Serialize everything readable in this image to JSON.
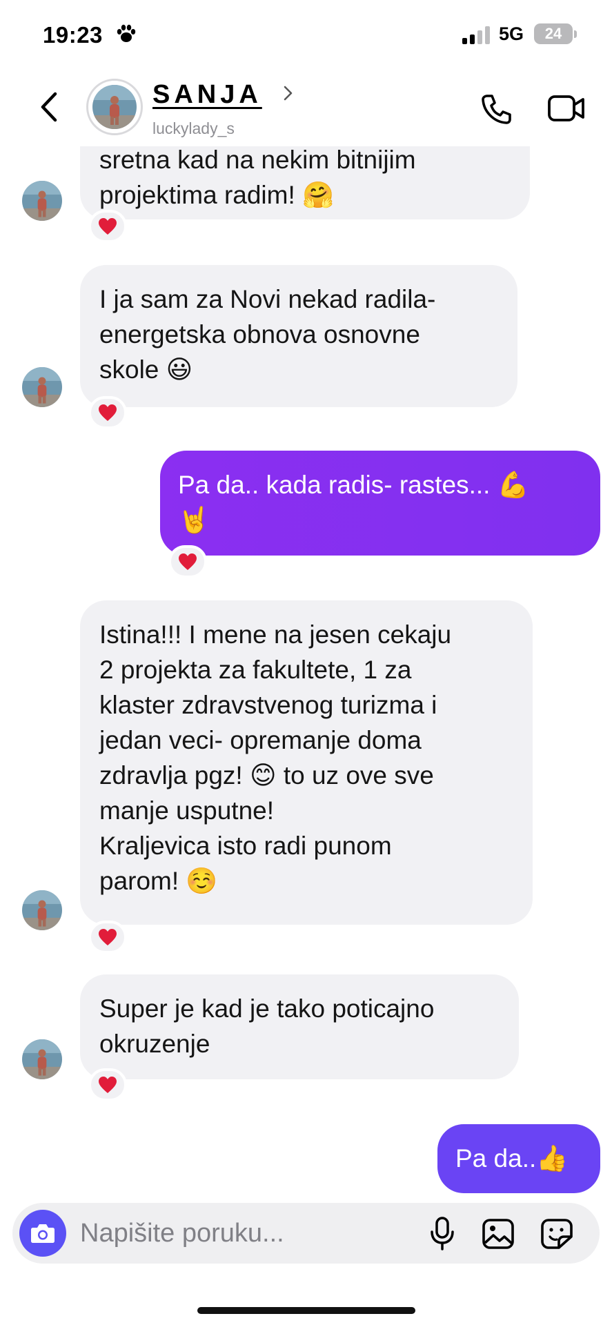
{
  "status_bar": {
    "time": "19:23",
    "network": "5G",
    "battery": "24",
    "icons": [
      "paw-icon",
      "signal-icon"
    ]
  },
  "header": {
    "contact_name": "SANJA",
    "contact_handle": "luckylady_s",
    "icons": [
      "back-icon",
      "chevron-right-icon",
      "phone-icon",
      "video-call-icon"
    ]
  },
  "colors": {
    "accent": "#5b51f5",
    "outgoing_purple": "#8a2ff0",
    "outgoing_indigo": "#6a44f4",
    "incoming_bubble": "#f1f1f4",
    "reaction_heart": "#e11d3a"
  },
  "messages": [
    {
      "direction": "incoming",
      "lines": [
        "sretna kad na nekim bitnijim",
        "projektima radim! 🤗"
      ],
      "reaction": "❤️"
    },
    {
      "direction": "incoming",
      "lines": [
        "I ja sam za Novi nekad radila-",
        "energetska obnova osnovne",
        "skole 😃"
      ],
      "reaction": "❤️"
    },
    {
      "direction": "outgoing",
      "lines": [
        "Pa da.. kada radis- rastes... 💪",
        "🤘"
      ],
      "reaction": "❤️"
    },
    {
      "direction": "incoming",
      "lines": [
        "Istina!!! I mene na jesen cekaju",
        "2 projekta za fakultete, 1 za",
        "klaster zdravstvenog turizma i",
        "jedan veci- opremanje doma",
        "zdravlja pgz! 😊 to uz ove sve",
        "manje usputne!",
        "Kraljevica isto radi punom",
        "parom! ☺️"
      ],
      "reaction": "❤️"
    },
    {
      "direction": "incoming",
      "lines": [
        "Super je kad je tako poticajno",
        "okruzenje"
      ],
      "reaction": "❤️"
    },
    {
      "direction": "outgoing",
      "lines": [
        "Pa da..👍"
      ],
      "reaction": ""
    }
  ],
  "composer": {
    "placeholder": "Napišite poruku...",
    "icons": [
      "camera-icon",
      "microphone-icon",
      "gallery-icon",
      "sticker-icon"
    ]
  }
}
